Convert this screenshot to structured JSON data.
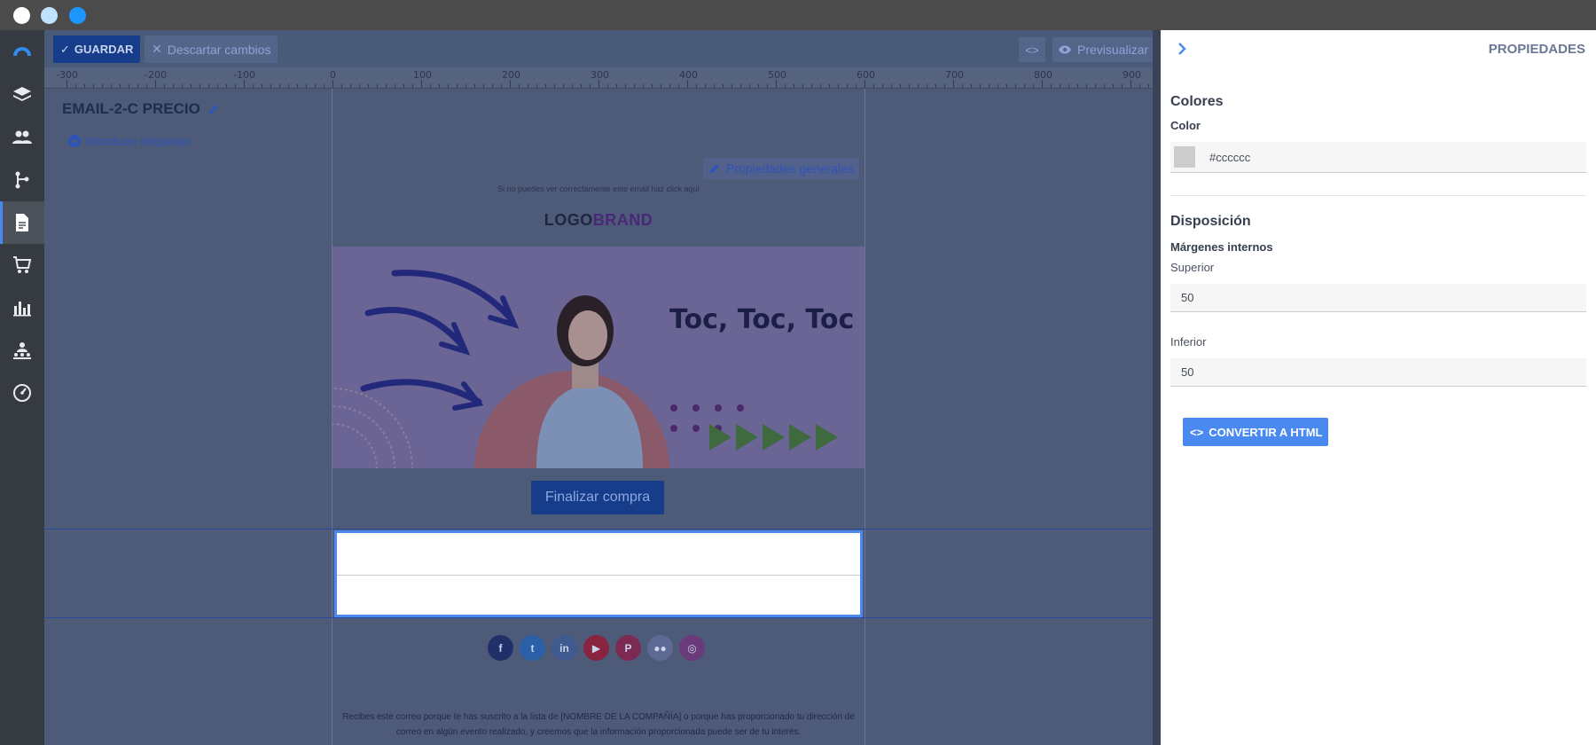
{
  "toolbar": {
    "save_label": "GUARDAR",
    "discard_label": "Descartar cambios",
    "code_label": "<>",
    "preview_label": "Previsualizar"
  },
  "ruler": {
    "labels": [
      "-300",
      "-200",
      "-100",
      "0",
      "100",
      "200",
      "300",
      "400",
      "500",
      "600",
      "700",
      "800",
      "900"
    ]
  },
  "editor": {
    "email_title": "EMAIL-2-C PRECIO",
    "tags_label": "Introduce etiquetas",
    "general_props_label": "Propiedades generales"
  },
  "email": {
    "preheader": "Si no puedes ver correctamente este email haz click aquí",
    "logo_part1": "LOGO",
    "logo_part2": "BRAND",
    "hero_text": "Toc, Toc, Toc",
    "cta_label": "Finalizar compra",
    "footer_text": "Recibes este correo porque te has suscrito a la lista de [NOMBRE DE LA COMPAÑÍA] o porque has proporcionado tu dirección de correo en algún evento realizado, y creemos que la información proporcionada puede ser de tu interés."
  },
  "socials": [
    {
      "name": "facebook-icon",
      "glyph": "f",
      "color": "#22306a"
    },
    {
      "name": "twitter-icon",
      "glyph": "t",
      "color": "#2b5fa8"
    },
    {
      "name": "linkedin-icon",
      "glyph": "in",
      "color": "#3f5a8e"
    },
    {
      "name": "youtube-icon",
      "glyph": "▶",
      "color": "#8a2340"
    },
    {
      "name": "pinterest-icon",
      "glyph": "P",
      "color": "#7d2a52"
    },
    {
      "name": "flickr-icon",
      "glyph": "●●",
      "color": "#5f6a94"
    },
    {
      "name": "instagram-icon",
      "glyph": "◎",
      "color": "#6a3a7a"
    }
  ],
  "panel": {
    "title": "PROPIEDADES",
    "colors_section": "Colores",
    "color_label": "Color",
    "color_value": "#cccccc",
    "layout_section": "Disposición",
    "padding_label": "Márgenes internos",
    "top_label": "Superior",
    "top_value": "50",
    "bottom_label": "Inferior",
    "bottom_value": "50",
    "convert_label": "CONVERTIR A HTML"
  },
  "colors": {
    "accent": "#4a8af0",
    "primary_button": "#163c8a",
    "divider_color": "#cccccc"
  }
}
